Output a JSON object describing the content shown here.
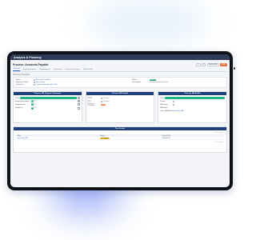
{
  "app": {
    "title": "Analysis & Planning"
  },
  "page": {
    "title": "Process: Accounts Payable",
    "actions": [
      "+",
      "▾",
      "Subscribe",
      "Edit"
    ]
  },
  "tabs": [
    "Overview",
    "Implementations",
    "Dependencies",
    "Resources",
    "Process Strategies",
    "Related Info"
  ],
  "process_info": {
    "label": "Process Information",
    "left": [
      {
        "key": "Name",
        "value": "Accounts Payable"
      },
      {
        "key": "Business Entity",
        "value": "Accounting"
      },
      {
        "key": "Owner(s)",
        "value": "Finance Manager; AP Clerk"
      }
    ],
    "right": [
      {
        "key": "Status",
        "value": "Active"
      },
      {
        "key": "Description",
        "value": "Manage vendor invoices"
      }
    ]
  },
  "progress_card": {
    "title": "Process Bill Progress Summary",
    "percent": "100%",
    "progress": 1.0,
    "rows": [
      {
        "label": "Impact Assessment",
        "value": "1/1"
      },
      {
        "label": "Dependencies",
        "value": "1/1"
      },
      {
        "label": "Resources",
        "value": "1/1"
      }
    ]
  },
  "health_card": {
    "title": "Process Bill Health",
    "rows": [
      {
        "key": "RPTO",
        "value": "24 Hours"
      },
      {
        "key": "RTO",
        "value": "24 Hours"
      },
      {
        "key": "Business Criticality",
        "value": "High"
      }
    ]
  },
  "audits_card": {
    "title": "Process Bill Audits",
    "percent": "100%",
    "progress": 1.0,
    "rows": [
      {
        "key": "Owner",
        "value": ""
      },
      {
        "key": "BIA Owner",
        "value": ""
      },
      {
        "key": "BIA Status",
        "value": ""
      },
      {
        "key": "Latest BIA Report",
        "value": "Accounting BIA"
      }
    ]
  },
  "plan_details": {
    "title": "Plan Details",
    "tools": "< 1 of 1 page >",
    "columns": [
      "Plan",
      "Status",
      "Date (UTC)"
    ],
    "rows": [
      {
        "plan": "Accounting BCP",
        "status": "In Progress",
        "date": "2024-03-12"
      }
    ],
    "footer": "< 1 of 1 page >"
  },
  "colors": {
    "appbar": "#2d3b56",
    "card_header": "#1d3f7a",
    "accent": "#f1733a",
    "success": "#25b37e",
    "link": "#2f64c9"
  }
}
